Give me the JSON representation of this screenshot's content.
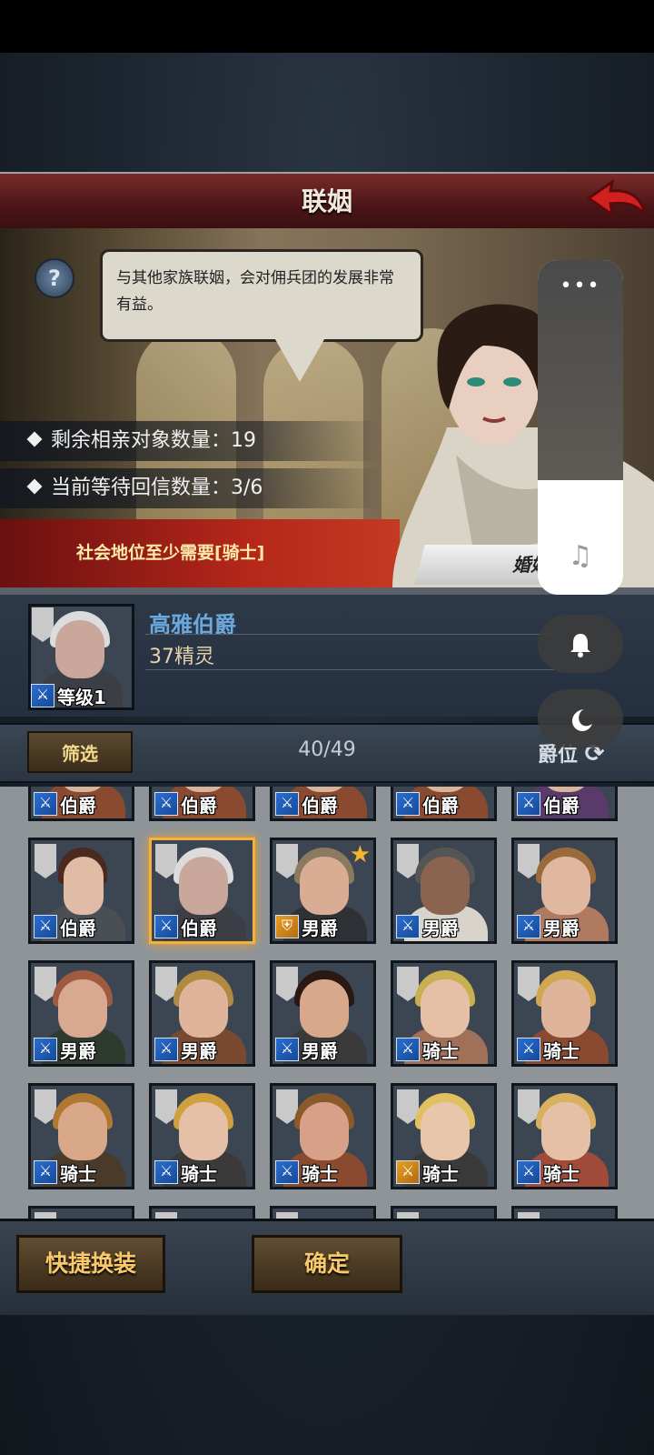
{
  "header": {
    "title": "联姻"
  },
  "speech": {
    "text": "与其他家族联姻，会对佣兵团的发展非常有益。"
  },
  "stats": [
    {
      "label": "剩余相亲对象数量：19"
    },
    {
      "label": "当前等待回信数量：3/6"
    }
  ],
  "requirement": "社会地位至少需要[骑士]",
  "marry_button": "婚姻",
  "selected": {
    "name": "高雅伯爵",
    "race": "37精灵",
    "level": "等级1"
  },
  "filter": {
    "label": "筛选",
    "count": "40/49",
    "sort_label": "爵位"
  },
  "grid": {
    "row0": [
      "伯爵",
      "伯爵",
      "伯爵",
      "伯爵",
      "伯爵"
    ],
    "row1": [
      "伯爵",
      "伯爵",
      "男爵",
      "男爵",
      "男爵"
    ],
    "row2": [
      "男爵",
      "男爵",
      "男爵",
      "骑士",
      "骑士"
    ],
    "row3": [
      "骑士",
      "骑士",
      "骑士",
      "骑士",
      "骑士"
    ]
  },
  "buttons": {
    "quick_equip": "快捷换装",
    "confirm": "确定"
  },
  "overlay": {
    "dots": "•••",
    "music_icon": "♫",
    "bell_icon": "bell-icon",
    "moon_icon": "moon-icon"
  },
  "icons": {
    "help": "?",
    "back": "back-arrow-icon",
    "refresh": "refresh-icon",
    "weapon": "sword-icon"
  },
  "colors": {
    "title_bar": "#4a1516",
    "requirement_bar": "#b3261a",
    "name": "#6aa8de",
    "button_text": "#f8c86a",
    "selected_border": "#f3b03a"
  }
}
